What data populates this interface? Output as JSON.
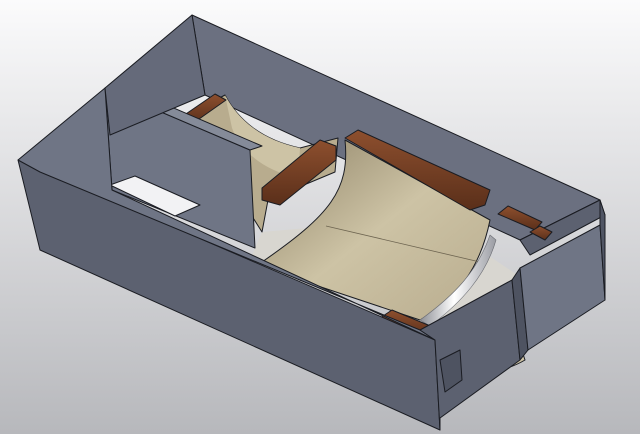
{
  "viewport": {
    "model": "3d-cad-box-assembly",
    "background_top": "#fbfbfc",
    "background_bottom": "#b7b8bc"
  },
  "colors": {
    "shell_dark": "#5c6170",
    "shell_mid": "#6f7585",
    "shell_light": "#858b99",
    "edge": "#1a1c22",
    "panel": "#b8ac8e",
    "panel_light": "#cdc3a5",
    "panel_dark": "#8e8266",
    "wood": "#6b3a22",
    "wood_light": "#8d4f2e",
    "metal": "#dcdde0"
  }
}
